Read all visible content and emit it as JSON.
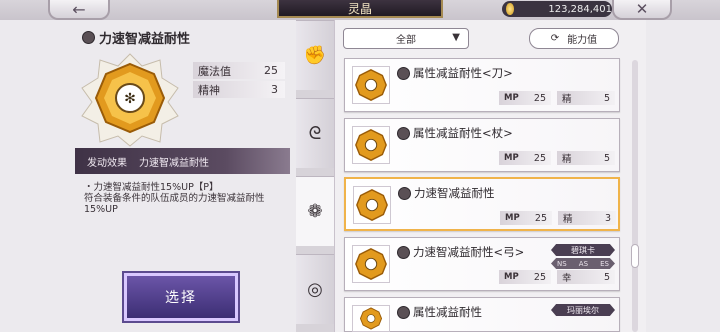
{
  "topbar": {
    "back_icon": "←",
    "title": "灵晶",
    "currency_amount": "123,284,401",
    "close_icon": "✕"
  },
  "detail": {
    "name": "力速智减益耐性",
    "stats": [
      {
        "label": "魔法值",
        "value": "25"
      },
      {
        "label": "精神",
        "value": "3"
      }
    ],
    "effect_label": "发动效果",
    "effect_name": "力速智减益耐性",
    "desc_line1": "・力速智减益耐性15%UP【P】",
    "desc_line2": "符合装备条件的队伍成员的力速智减益耐性",
    "desc_line3": "15%UP",
    "select_label": "选择"
  },
  "side_tabs": [
    {
      "icon": "fist-icon",
      "glyph": "✊"
    },
    {
      "icon": "swirl-icon",
      "glyph": "ᘓ"
    },
    {
      "icon": "gear-emblem-icon",
      "glyph": "❁"
    },
    {
      "icon": "spiral-icon",
      "glyph": "◎"
    }
  ],
  "filter": {
    "value": "全部",
    "arrow": "▼",
    "sort_icon": "⟳",
    "sort_label": "能力值"
  },
  "list": [
    {
      "name": "属性减益耐性<刀>",
      "mp_label": "MP",
      "mp": "25",
      "stat_label": "精",
      "stat": "5"
    },
    {
      "name": "属性减益耐性<杖>",
      "mp_label": "MP",
      "mp": "25",
      "stat_label": "精",
      "stat": "5"
    },
    {
      "name": "力速智减益耐性",
      "mp_label": "MP",
      "mp": "25",
      "stat_label": "精",
      "stat": "3"
    },
    {
      "name": "力速智减益耐性<弓>",
      "mp_label": "MP",
      "mp": "25",
      "stat_label": "幸",
      "stat": "5",
      "equipped_by": "碧琪卡",
      "styles": [
        "NS",
        "AS",
        "ES"
      ]
    },
    {
      "name": "属性减益耐性",
      "equipped_by": "玛丽埃尔"
    }
  ],
  "colors": {
    "accent_gold": "#f0b34a",
    "header_dark": "#201a24",
    "select_purple": "#4a3a8c"
  }
}
